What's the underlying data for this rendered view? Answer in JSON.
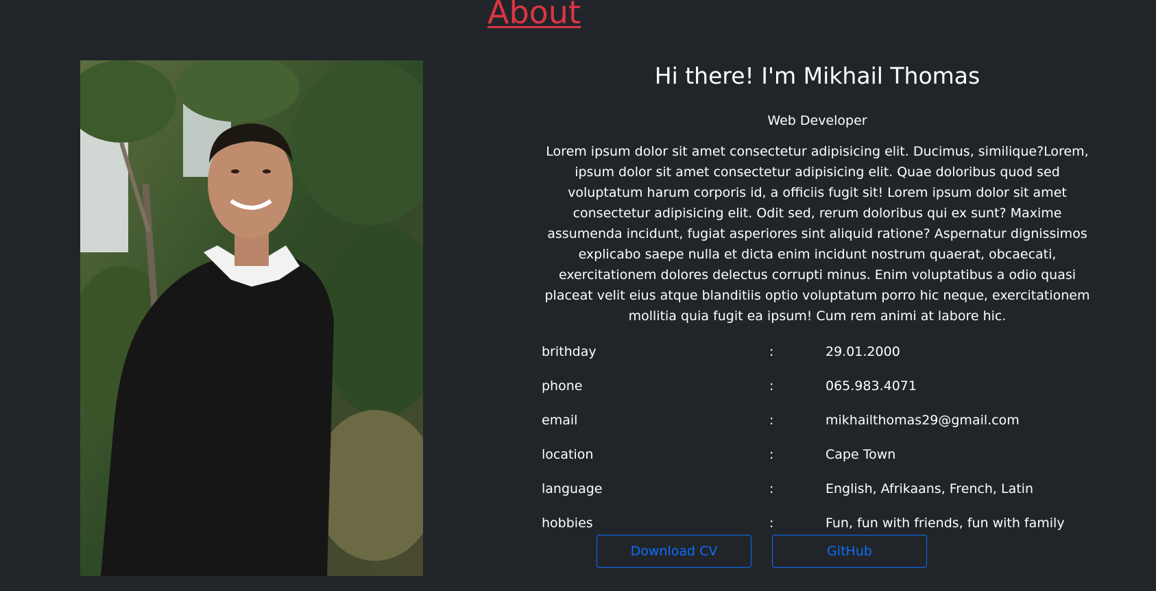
{
  "about": {
    "title": "About",
    "title_color": "#dc3545"
  },
  "photo": {
    "alt": "Portrait of Mikhail Thomas"
  },
  "intro": {
    "greeting": "Hi there! I'm Mikhail Thomas",
    "role": "Web Developer",
    "bio": "Lorem ipsum dolor sit amet consectetur adipisicing elit. Ducimus, similique?Lorem, ipsum dolor sit amet consectetur adipisicing elit. Quae doloribus quod sed voluptatum harum corporis id, a officiis fugit sit! Lorem ipsum dolor sit amet consectetur adipisicing elit. Odit sed, rerum doloribus qui ex sunt? Maxime assumenda incidunt, fugiat asperiores sint aliquid ratione? Aspernatur dignissimos explicabo saepe nulla et dicta enim incidunt nostrum quaerat, obcaecati, exercitationem dolores delectus corrupti minus. Enim voluptatibus a odio quasi placeat velit eius atque blanditiis optio voluptatum porro hic neque, exercitationem mollitia quia fugit ea ipsum! Cum rem animi at labore hic."
  },
  "details": {
    "separator": ":",
    "rows": [
      {
        "label": "brithday",
        "value": "29.01.2000"
      },
      {
        "label": "phone",
        "value": "065.983.4071"
      },
      {
        "label": "email",
        "value": "mikhailthomas29@gmail.com"
      },
      {
        "label": "location",
        "value": "Cape Town"
      },
      {
        "label": "language",
        "value": "English, Afrikaans, French, Latin"
      },
      {
        "label": "hobbies",
        "value": "Fun, fun with friends, fun with family"
      }
    ]
  },
  "buttons": {
    "download_cv": "Download CV",
    "github": "GitHub",
    "accent_color": "#0d6efd"
  },
  "theme": {
    "background": "#212529",
    "text": "#ffffff"
  }
}
